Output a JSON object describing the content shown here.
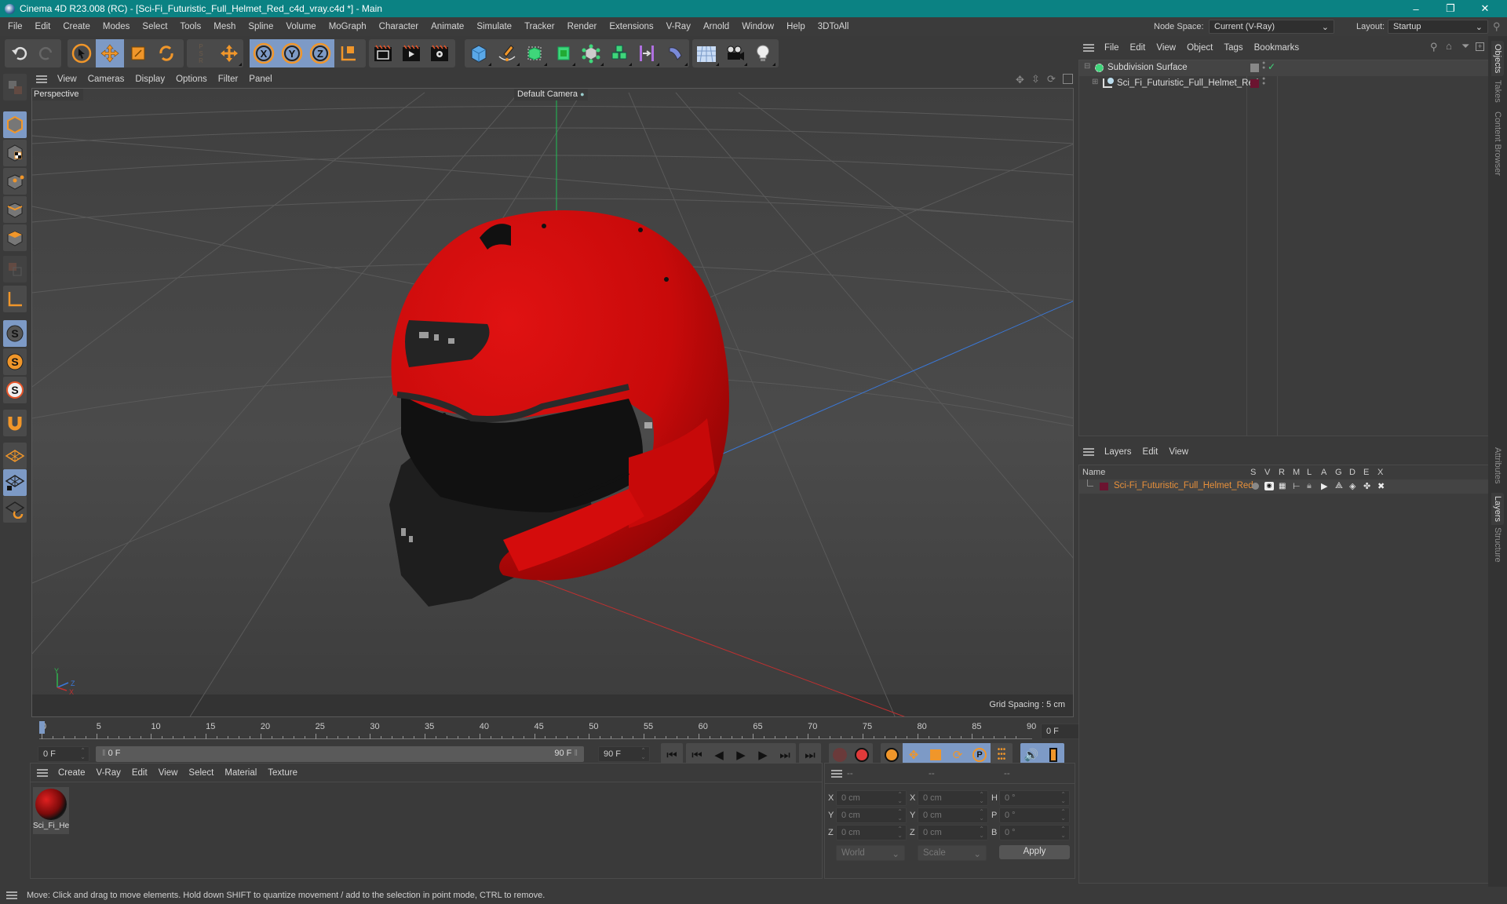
{
  "window": {
    "title": "Cinema 4D R23.008 (RC) - [Sci-Fi_Futuristic_Full_Helmet_Red_c4d_vray.c4d *] - Main",
    "controls": {
      "minimize": "–",
      "restore": "❐",
      "close": "✕"
    }
  },
  "menubar": {
    "items": [
      "File",
      "Edit",
      "Create",
      "Modes",
      "Select",
      "Tools",
      "Mesh",
      "Spline",
      "Volume",
      "MoGraph",
      "Character",
      "Animate",
      "Simulate",
      "Tracker",
      "Render",
      "Extensions",
      "V-Ray",
      "Arnold",
      "Window",
      "Help",
      "3DToAll"
    ],
    "node_space_label": "Node Space:",
    "node_space_value": "Current (V-Ray)",
    "layout_label": "Layout:",
    "layout_value": "Startup"
  },
  "toolbar": {
    "groups": [
      [
        "undo-icon",
        "redo-icon"
      ],
      [
        "live-selection-icon",
        "move-icon",
        "scale-icon",
        "rotate-icon"
      ],
      [
        "psr-icon",
        "move-axis-icon"
      ],
      [
        "x-axis-lock-icon",
        "y-axis-lock-icon",
        "z-axis-lock-icon",
        "coordinate-system-icon"
      ],
      [
        "render-view-icon",
        "render-picture-viewer-icon",
        "render-settings-icon"
      ],
      [
        "cube-icon",
        "pen-spline-icon",
        "subdivision-surface-icon",
        "extrude-icon",
        "mograph-cloner-icon",
        "array-icon",
        "symmetry-icon",
        "deformer-bend-icon"
      ],
      [
        "floor-icon",
        "camera-icon",
        "light-icon"
      ]
    ],
    "selected": [
      "move-icon",
      "x-axis-lock-icon",
      "y-axis-lock-icon",
      "z-axis-lock-icon"
    ]
  },
  "left_tools": [
    "make-editable-icon",
    "model-mode-icon",
    "texture-mode-icon",
    "points-mode-icon",
    "edges-mode-icon",
    "polygons-mode-icon",
    "uvw-mode-icon",
    "axis-mode-icon",
    "snap-icon",
    "soft-selection-icon",
    "tweak-icon",
    "magnet-icon",
    "workplane-icon",
    "locked-workplane-icon",
    "workplane-align-icon"
  ],
  "viewport": {
    "menu": [
      "View",
      "Cameras",
      "Display",
      "Options",
      "Filter",
      "Panel"
    ],
    "label": "Perspective",
    "camera": "Default Camera",
    "grid_spacing": "Grid Spacing : 5 cm",
    "axis_labels": {
      "x": "X",
      "y": "Y",
      "z": "Z"
    },
    "nav_icons": [
      "move-view-icon",
      "zoom-view-icon",
      "rotate-view-icon",
      "maximize-view-icon"
    ]
  },
  "timeline": {
    "ticks": [
      "0",
      "5",
      "10",
      "15",
      "20",
      "25",
      "30",
      "35",
      "40",
      "45",
      "50",
      "55",
      "60",
      "65",
      "70",
      "75",
      "80",
      "85",
      "90"
    ],
    "current_frame": "0 F",
    "start_field": "0 F",
    "range_start": "0 F",
    "range_end": "90 F",
    "end_field": "90 F",
    "current_field_right": "0 F"
  },
  "material_panel": {
    "menu": [
      "Create",
      "V-Ray",
      "Edit",
      "View",
      "Select",
      "Material",
      "Texture"
    ],
    "materials": [
      {
        "name": "Sci_Fi_He"
      }
    ]
  },
  "coord_panel": {
    "headers": [
      "--",
      "--",
      "--"
    ],
    "rows": [
      {
        "l1": "X",
        "v1": "0 cm",
        "l2": "X",
        "v2": "0 cm",
        "l3": "H",
        "v3": "0 °"
      },
      {
        "l1": "Y",
        "v1": "0 cm",
        "l2": "Y",
        "v2": "0 cm",
        "l3": "P",
        "v3": "0 °"
      },
      {
        "l1": "Z",
        "v1": "0 cm",
        "l2": "Z",
        "v2": "0 cm",
        "l3": "B",
        "v3": "0 °"
      }
    ],
    "mode": "World",
    "transform": "Scale",
    "apply": "Apply"
  },
  "object_manager": {
    "menu": [
      "File",
      "Edit",
      "View",
      "Object",
      "Tags",
      "Bookmarks"
    ],
    "objects": [
      {
        "name": "Subdivision Surface",
        "expanded": true
      },
      {
        "name": "Sci_Fi_Futuristic_Full_Helmet_Red",
        "expanded": false,
        "layer_color": "#6b1430"
      }
    ]
  },
  "layer_manager": {
    "menu": [
      "Layers",
      "Edit",
      "View"
    ],
    "columns": [
      "Name",
      "S",
      "V",
      "R",
      "M",
      "L",
      "A",
      "G",
      "D",
      "E",
      "X"
    ],
    "layers": [
      {
        "name": "Sci-Fi_Futuristic_Full_Helmet_Red",
        "color": "#6b1430"
      }
    ]
  },
  "side_tabs": {
    "top": [
      "Objects",
      "Takes",
      "Content Browser"
    ],
    "bottom": [
      "Attributes",
      "Layers",
      "Structure"
    ]
  },
  "statusbar": {
    "text": "Move: Click and drag to move elements. Hold down SHIFT to quantize movement / add to the selection in point mode, CTRL to remove."
  },
  "colors": {
    "accent_title": "#0b8283",
    "selected_tool": "#7d9ac6",
    "orange_icon": "#f0962a",
    "helmet_red": "#d10b0b",
    "layer_name": "#e8903a"
  }
}
